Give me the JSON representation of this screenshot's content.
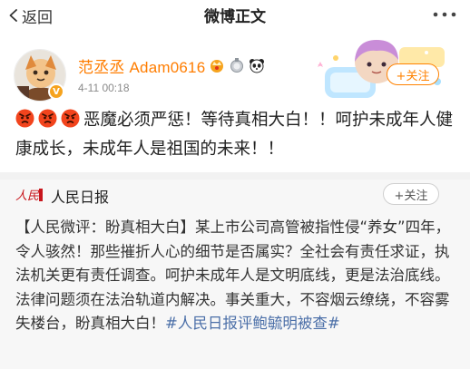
{
  "nav": {
    "back_label": "返回",
    "title": "微博正文",
    "more_icon": "more-dots-icon"
  },
  "post": {
    "author": "范丞丞 Adam0616",
    "time": "4-11 00:18",
    "follow_label": "+关注",
    "emoji": [
      "angry-face-emoji",
      "angry-face-emoji",
      "angry-face-emoji"
    ],
    "text": "恶魔必须严惩！等待真相大白！！呵护未成年人健康成长，未成年人是祖国的未来！！",
    "colors": {
      "author": "#ff7d00",
      "follow": "#ff8200"
    }
  },
  "repost": {
    "author": "人民日报",
    "follow_label": "+关注",
    "text": "【人民微评：盼真相大白】某上市公司高管被指性侵“养女”四年，令人骇然！那些摧折人心的细节是否属实？全社会有责任求证，执法机关更有责任调查。呵护未成年人是文明底线，更是法治底线。法律问题须在法治轨道内解决。事关重大，不容烟云缭绕，不容雾失楼台，盼真相大白！",
    "hashtag": "#人民日报评鲍毓明被查#",
    "colors": {
      "hashtag": "#4b6fa8"
    }
  }
}
